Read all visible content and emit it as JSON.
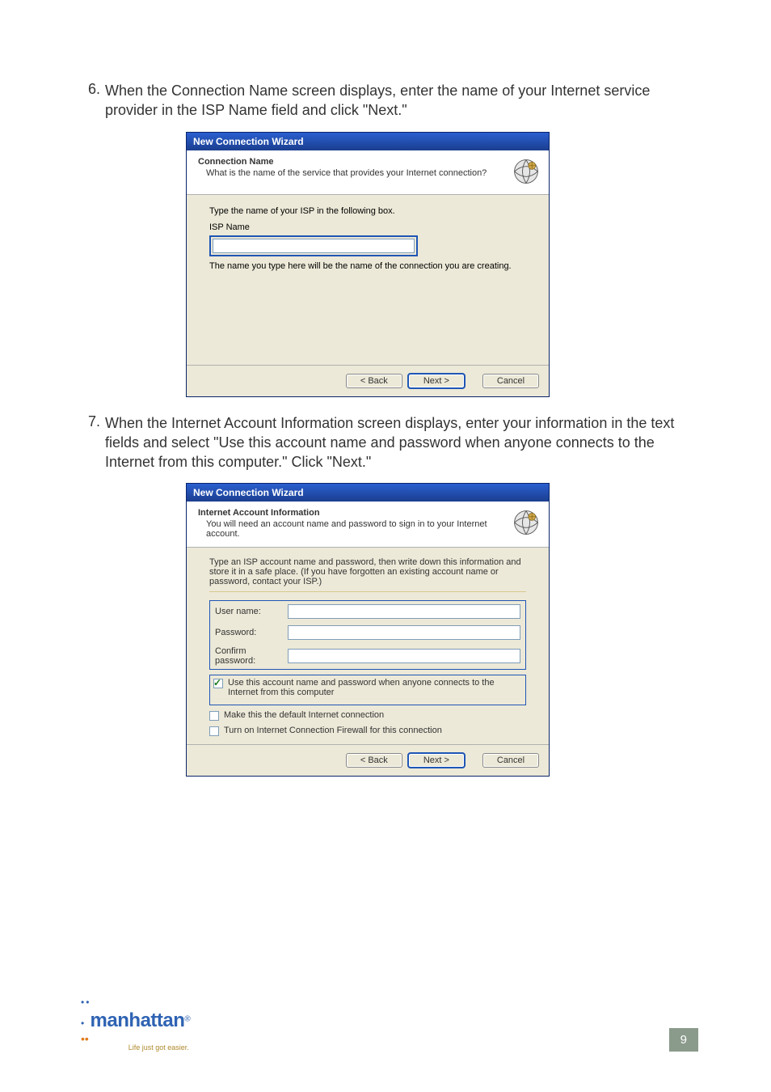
{
  "steps": {
    "s6": {
      "num": "6.",
      "text": "When the Connection Name screen displays, enter the name of your Internet service provider in the ISP Name field and click \"Next.\""
    },
    "s7": {
      "num": "7.",
      "text": "When the Internet Account Information screen displays, enter your information in the text fields and select \"Use this account name and password when anyone connects to the Internet from this computer.\" Click \"Next.\""
    }
  },
  "wizard1": {
    "title": "New Connection Wizard",
    "heading": "Connection Name",
    "subheading": "What is the name of the service that provides your Internet connection?",
    "prompt": "Type the name of your ISP in the following box.",
    "field_label": "ISP Name",
    "note": "The name you type here will be the name of the connection you are creating.",
    "buttons": {
      "back": "< Back",
      "next": "Next >",
      "cancel": "Cancel"
    }
  },
  "wizard2": {
    "title": "New Connection Wizard",
    "heading": "Internet Account Information",
    "subheading": "You will need an account name and password to sign in to your Internet account.",
    "prompt": "Type an ISP account name and password, then write down this information and store it in a safe place. (If you have forgotten an existing account name or password, contact your ISP.)",
    "fields": {
      "user": "User name:",
      "pass": "Password:",
      "confirm": "Confirm password:"
    },
    "checks": {
      "c1": "Use this account name and password when anyone connects to the Internet from this computer",
      "c2": "Make this the default Internet connection",
      "c3": "Turn on Internet Connection Firewall for this connection"
    },
    "buttons": {
      "back": "< Back",
      "next": "Next >",
      "cancel": "Cancel"
    }
  },
  "footer": {
    "logo_main": "manhattan",
    "logo_tag": "Life just got easier.",
    "page": "9"
  }
}
